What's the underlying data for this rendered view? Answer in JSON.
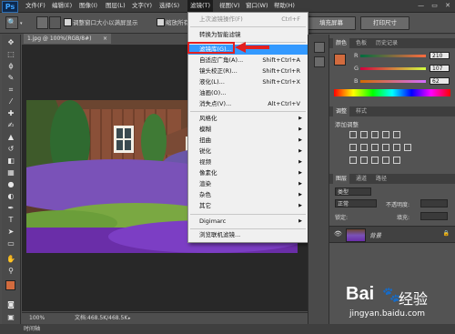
{
  "menubar": {
    "logo": "Ps",
    "items": [
      "文件(F)",
      "编辑(E)",
      "图像(I)",
      "图层(L)",
      "文字(Y)",
      "选择(S)",
      "滤镜(T)",
      "视图(V)",
      "窗口(W)",
      "帮助(H)"
    ],
    "window_controls": "— ▭ ✕"
  },
  "options": {
    "checkbox1_label": "调整窗口大小以满屏显示",
    "checkbox2_label": "缩放所有",
    "fill_screen": "填充屏幕",
    "print_size": "打印尺寸"
  },
  "document": {
    "tab_title": "1.jpg @ 100%(RGB/8#)",
    "tab_close": "×",
    "zoom": "100%",
    "doc_info": "文档:468.5K/468.5K",
    "bottom_label": "时间轴"
  },
  "filter_menu": {
    "items": [
      {
        "label": "上次滤镜操作(F)",
        "shortcut": "Ctrl+F",
        "disabled": true
      },
      {
        "label": "转换为智能滤镜"
      },
      {
        "label": "滤镜库(G)...",
        "highlighted": true
      },
      {
        "label": "自适应广角(A)...",
        "shortcut": "Shift+Ctrl+A"
      },
      {
        "label": "镜头校正(R)...",
        "shortcut": "Shift+Ctrl+R"
      },
      {
        "label": "液化(L)...",
        "shortcut": "Shift+Ctrl+X"
      },
      {
        "label": "油画(O)..."
      },
      {
        "label": "消失点(V)...",
        "shortcut": "Alt+Ctrl+V"
      },
      {
        "label": "风格化",
        "submenu": true
      },
      {
        "label": "模糊",
        "submenu": true
      },
      {
        "label": "扭曲",
        "submenu": true
      },
      {
        "label": "锐化",
        "submenu": true
      },
      {
        "label": "视频",
        "submenu": true
      },
      {
        "label": "像素化",
        "submenu": true
      },
      {
        "label": "渲染",
        "submenu": true
      },
      {
        "label": "杂色",
        "submenu": true
      },
      {
        "label": "其它",
        "submenu": true
      },
      {
        "label": "Digimarc",
        "submenu": true
      },
      {
        "label": "浏览联机滤镜..."
      }
    ]
  },
  "color_panel": {
    "tabs": [
      "颜色",
      "色板",
      "历史记录"
    ],
    "channels": [
      {
        "name": "R",
        "value": "210"
      },
      {
        "name": "G",
        "value": "107"
      },
      {
        "name": "B",
        "value": "62"
      }
    ],
    "foreground": "#d26b3e"
  },
  "adjust_panel": {
    "tabs": [
      "调整",
      "样式"
    ],
    "title": "添加调整"
  },
  "layers_panel": {
    "tabs": [
      "图层",
      "通道",
      "路径"
    ],
    "kind": "类型",
    "blend_mode": "正常",
    "opacity_label": "不透明度:",
    "lock_label": "锁定:",
    "fill_label": "填充:",
    "layer_name": "背景"
  },
  "watermark": {
    "brand": "Bai",
    "brand2": "经验",
    "url": "jingyan.baidu.com"
  }
}
